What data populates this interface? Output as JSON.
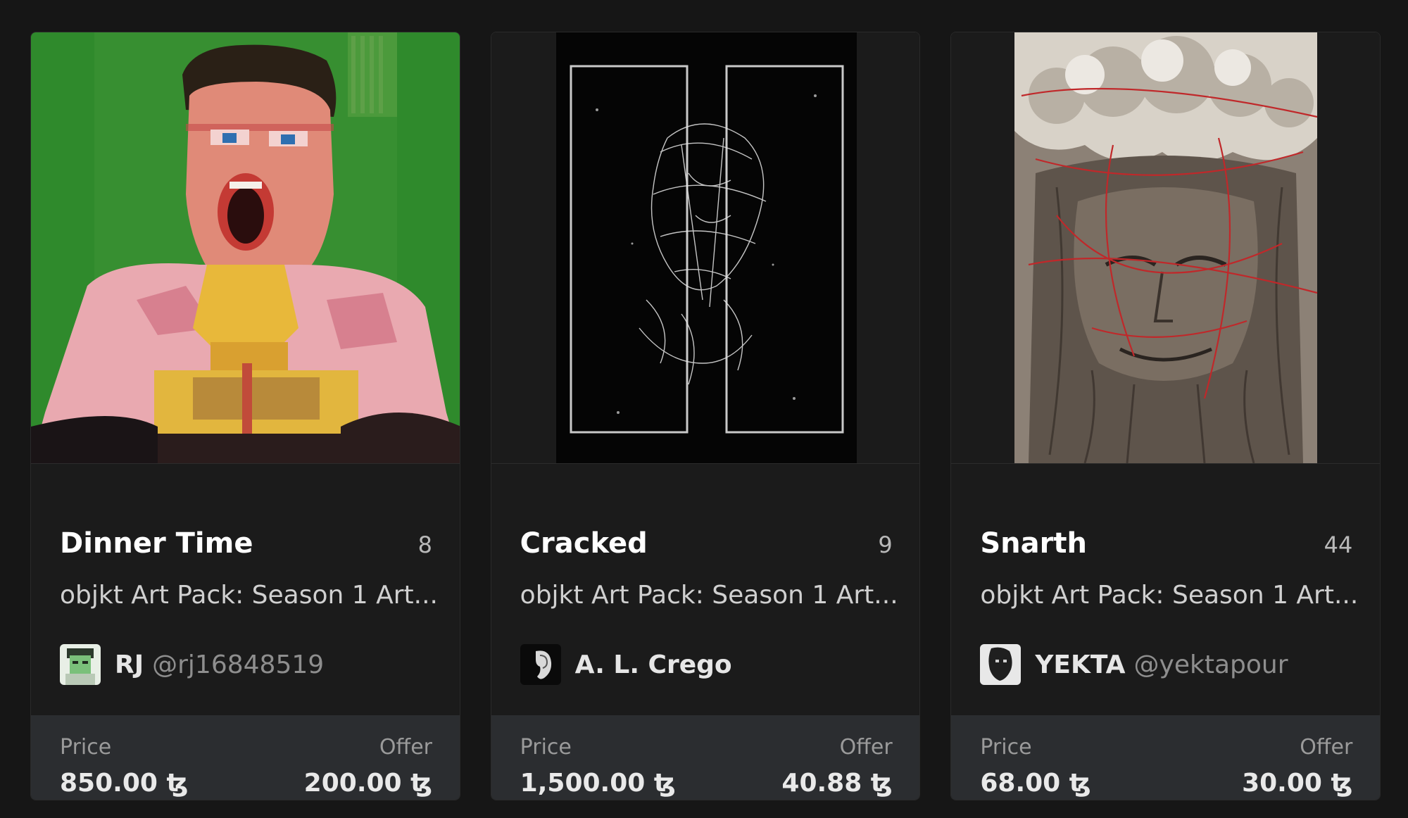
{
  "cards": [
    {
      "title": "Dinner Time",
      "edition": "8",
      "collection": "objkt Art Pack: Season 1 Art...",
      "artist": {
        "name": "RJ",
        "handle": "@rj16848519",
        "avatar": "pixel-portrait-avatar"
      },
      "price_label": "Price",
      "price": "850.00 ꜩ",
      "offer_label": "Offer",
      "offer": "200.00 ꜩ",
      "artwork": "screaming-man-pixel-art",
      "colors": {
        "background": "#2f8a2c"
      }
    },
    {
      "title": "Cracked",
      "edition": "9",
      "collection": "objkt Art Pack: Season 1 Art...",
      "artist": {
        "name": "A. L. Crego",
        "handle": "",
        "avatar": "ear-avatar"
      },
      "price_label": "Price",
      "price": "1,500.00 ꜩ",
      "offer_label": "Offer",
      "offer": "40.88 ꜩ",
      "artwork": "white-line-face-on-black",
      "colors": {
        "background": "#050505"
      }
    },
    {
      "title": "Snarth",
      "edition": "44",
      "collection": "objkt Art Pack: Season 1 Art...",
      "artist": {
        "name": "YEKTA",
        "handle": "@yektapour",
        "avatar": "face-avatar"
      },
      "price_label": "Price",
      "price": "68.00 ꜩ",
      "offer_label": "Offer",
      "offer": "30.00 ꜩ",
      "artwork": "clouds-and-face-drawing",
      "colors": {
        "background": "#8c8176"
      }
    }
  ]
}
